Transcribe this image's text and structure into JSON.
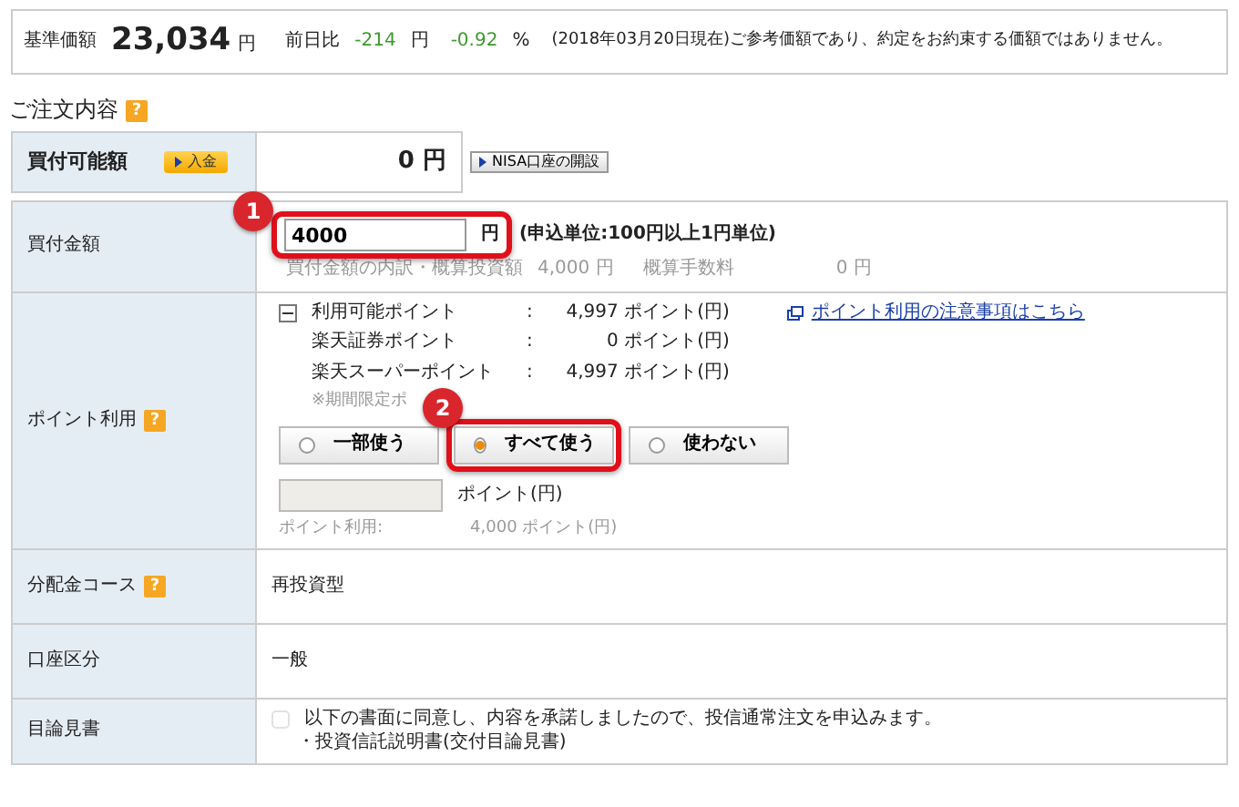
{
  "price_header": {
    "label": "基準価額",
    "value": "23,034",
    "unit": "円",
    "change_label": "前日比",
    "change": "-214",
    "change_unit": "円",
    "change_pct": "-0.92",
    "pct_unit": "%",
    "note": "(2018年03月20日現在)ご参考価額であり、約定をお約束する価額ではありません。"
  },
  "section": {
    "title": "ご注文内容",
    "help": "?"
  },
  "buying_power": {
    "label": "買付可能額",
    "deposit_button": "入金",
    "amount": "0 円",
    "nisa_button": "NISA口座の開設"
  },
  "purchase": {
    "label": "買付金額",
    "value": "4000",
    "unit": "円",
    "unit_note": "(申込単位:100円以上1円単位)",
    "breakdown_label": "買付金額の内訳・概算投資額",
    "breakdown_value": "4,000 円",
    "fee_label": "概算手数料",
    "fee_value": "0 円"
  },
  "points": {
    "label": "ポイント利用",
    "help": "?",
    "expanded": true,
    "balances": [
      {
        "label": "利用可能ポイント",
        "sep": ":",
        "value": "4,997 ポイント(円)"
      },
      {
        "label": "楽天証券ポイント",
        "sep": ":",
        "value": "0 ポイント(円)"
      },
      {
        "label": "楽天スーパーポイント",
        "sep": ":",
        "value": "4,997 ポイント(円)"
      }
    ],
    "link": "ポイント利用の注意事項はこちら",
    "note": "※期間限定ポ",
    "options": [
      {
        "label": "一部使う",
        "selected": false
      },
      {
        "label": "すべて使う",
        "selected": true
      },
      {
        "label": "使わない",
        "selected": false
      }
    ],
    "input_unit": "ポイント(円)",
    "usage_label": "ポイント利用:",
    "usage_value": "4,000 ポイント(円)"
  },
  "distribution": {
    "label": "分配金コース",
    "help": "?",
    "value": "再投資型"
  },
  "account": {
    "label": "口座区分",
    "value": "一般"
  },
  "prospectus": {
    "label": "目論見書",
    "checked": false,
    "text": "以下の書面に同意し、内容を承諾しましたので、投信通常注文を申込みます。",
    "item": "・投資信託説明書(交付目論見書)"
  },
  "annotations": [
    {
      "number": "1"
    },
    {
      "number": "2"
    }
  ]
}
